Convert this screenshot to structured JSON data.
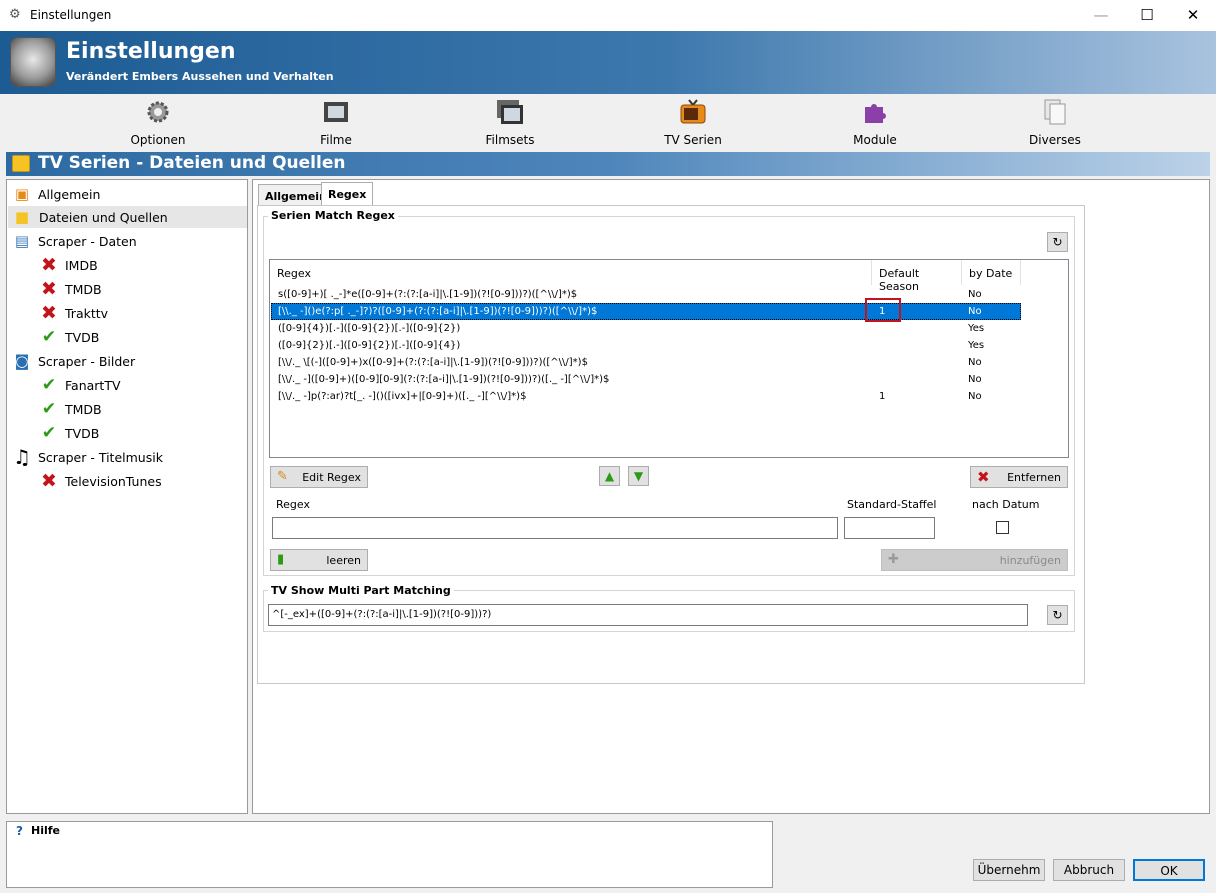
{
  "window": {
    "title": "Einstellungen",
    "minimize": "—",
    "maximize": "☐",
    "close": "✕"
  },
  "banner": {
    "title": "Einstellungen",
    "subtitle": "Verändert Embers Aussehen und Verhalten"
  },
  "toolbar": [
    {
      "label": "Optionen",
      "icon": "gear-icon"
    },
    {
      "label": "Filme",
      "icon": "film-icon"
    },
    {
      "label": "Filmsets",
      "icon": "filmset-icon"
    },
    {
      "label": "TV Serien",
      "icon": "tv-icon"
    },
    {
      "label": "Module",
      "icon": "puzzle-icon"
    },
    {
      "label": "Diverses",
      "icon": "documents-icon"
    }
  ],
  "section": {
    "title": "TV Serien - Dateien und Quellen"
  },
  "tree": [
    {
      "label": "Allgemein",
      "icon": "tv-icon"
    },
    {
      "label": "Dateien und Quellen",
      "icon": "folder-icon",
      "selected": true
    },
    {
      "label": "Scraper - Daten",
      "icon": "scraper-data-icon"
    },
    {
      "label": "IMDB",
      "icon": "x-icon"
    },
    {
      "label": "TMDB",
      "icon": "x-icon"
    },
    {
      "label": "Trakttv",
      "icon": "x-icon"
    },
    {
      "label": "TVDB",
      "icon": "check-icon"
    },
    {
      "label": "Scraper - Bilder",
      "icon": "scraper-images-icon"
    },
    {
      "label": "FanartTV",
      "icon": "check-icon"
    },
    {
      "label": "TMDB",
      "icon": "check-icon"
    },
    {
      "label": "TVDB",
      "icon": "check-icon"
    },
    {
      "label": "Scraper - Titelmusik",
      "icon": "music-icon"
    },
    {
      "label": "TelevisionTunes",
      "icon": "x-icon"
    }
  ],
  "tabs": [
    {
      "label": "Allgemein"
    },
    {
      "label": "Regex",
      "active": true
    }
  ],
  "serien_match": {
    "group_label": "Serien Match Regex",
    "columns": [
      "Regex",
      "Default Season",
      "by Date"
    ],
    "rows": [
      {
        "regex": "s([0-9]+)[ ._-]*e([0-9]+(?:(?:[a-i]|\\.[1-9])(?![0-9]))?)([^\\\\/]*)$",
        "season": "",
        "bydate": "No"
      },
      {
        "regex": "[\\\\._ -]()e(?:p[ ._-]?)?([0-9]+(?:(?:[a-i]|\\.[1-9])(?![0-9]))?)([^\\\\/]*)$",
        "season": "1",
        "bydate": "No",
        "selected": true
      },
      {
        "regex": "([0-9]{4})[.-]([0-9]{2})[.-]([0-9]{2})",
        "season": "",
        "bydate": "Yes"
      },
      {
        "regex": "([0-9]{2})[.-]([0-9]{2})[.-]([0-9]{4})",
        "season": "",
        "bydate": "Yes"
      },
      {
        "regex": "[\\\\/._ \\[(-]([0-9]+)x([0-9]+(?:(?:[a-i]|\\.[1-9])(?![0-9]))?)([^\\\\/]*)$",
        "season": "",
        "bydate": "No"
      },
      {
        "regex": "[\\\\/._ -]([0-9]+)([0-9][0-9](?:(?:[a-i]|\\.[1-9])(?![0-9]))?)([._ -][^\\\\/]*)$",
        "season": "",
        "bydate": "No"
      },
      {
        "regex": "[\\\\/._ -]p(?:ar)?t[_. -]()([ivx]+|[0-9]+)([._ -][^\\\\/]*)$",
        "season": "1",
        "bydate": "No"
      }
    ],
    "edit_button": "Edit Regex",
    "remove_button": "Entfernen",
    "regex_label": "Regex",
    "staffel_label": "Standard-Staffel",
    "datum_label": "nach Datum",
    "regex_value": "",
    "staffel_value": "",
    "clear_button": "leeren",
    "add_button": "hinzufügen"
  },
  "multipart": {
    "group_label": "TV Show Multi Part Matching",
    "value": "^[-_ex]+([0-9]+(?:(?:[a-i]|\\.[1-9])(?![0-9]))?)"
  },
  "help": {
    "label": "Hilfe"
  },
  "footer": {
    "apply": "Übernehm",
    "cancel": "Abbruch",
    "ok": "OK"
  }
}
